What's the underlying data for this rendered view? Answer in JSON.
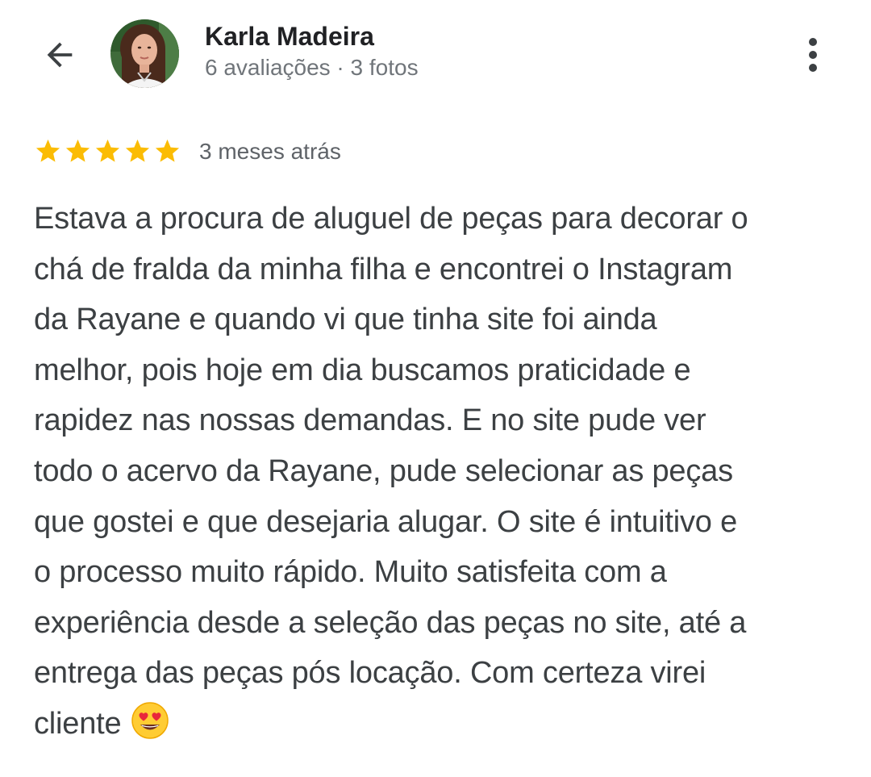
{
  "header": {
    "back_icon": "arrow-left-icon",
    "author_name": "Karla Madeira",
    "author_meta": "6 avaliações · 3 fotos",
    "more_icon": "more-vertical-icon"
  },
  "review": {
    "rating": 5,
    "max_rating": 5,
    "star_color": "#fbbc04",
    "date": "3 meses atrás",
    "lines": [
      "Estava a procura de aluguel de peças para decorar o",
      "chá de fralda da minha filha e encontrei o Instagram",
      "da Rayane e quando vi que tinha site foi ainda",
      "melhor, pois hoje em dia buscamos praticidade e",
      "rapidez nas nossas demandas. E no site pude ver",
      "todo o acervo da Rayane, pude selecionar as peças",
      "que gostei e que desejaria alugar. O site é intuitivo e",
      "o processo muito rápido. Muito satisfeita com a",
      "experiência desde a seleção das peças no site, até a",
      "entrega das peças pós locação. Com certeza virei",
      "cliente"
    ],
    "end_emoji": "heart-eyes-emoji"
  }
}
